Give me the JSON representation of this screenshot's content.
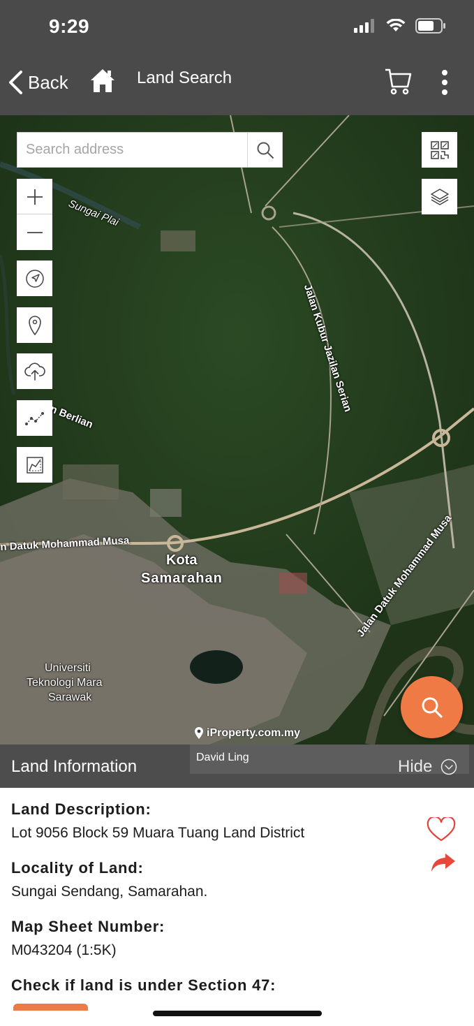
{
  "status": {
    "time": "9:29"
  },
  "nav": {
    "back_label": "Back",
    "title": "Land Search"
  },
  "map": {
    "search_placeholder": "Search address",
    "labels": {
      "river": "Sungai Plai",
      "road_kubur": "Jalan Kubur Jazilan Serian",
      "road_berlian": "n Berlian",
      "road_datuk_left": "n Datuk Mohammad Musa",
      "road_datuk_right": "Jalan Datuk Mohammad Musa",
      "town_line1": "Kota",
      "town_line2": "Samarahan",
      "uni_line1": "Universiti",
      "uni_line2": "Teknologi Mara",
      "uni_line3": "Sarawak"
    },
    "watermark": "iProperty.com.my"
  },
  "info_bar": {
    "title": "Land Information",
    "owner": "David Ling",
    "hide_label": "Hide"
  },
  "details": {
    "land_description_label": "Land Description:",
    "land_description_value": "Lot 9056 Block 59 Muara Tuang Land District",
    "locality_label": "Locality of Land:",
    "locality_value": "Sungai Sendang, Samarahan.",
    "map_sheet_label": "Map Sheet Number:",
    "map_sheet_value": "M043204 (1:5K)",
    "section47_label": "Check if land is under Section 47:"
  },
  "colors": {
    "nav_bg": "#4a4a4a",
    "accent": "#f07a45",
    "heart": "#e0443a",
    "share": "#e8483b"
  }
}
